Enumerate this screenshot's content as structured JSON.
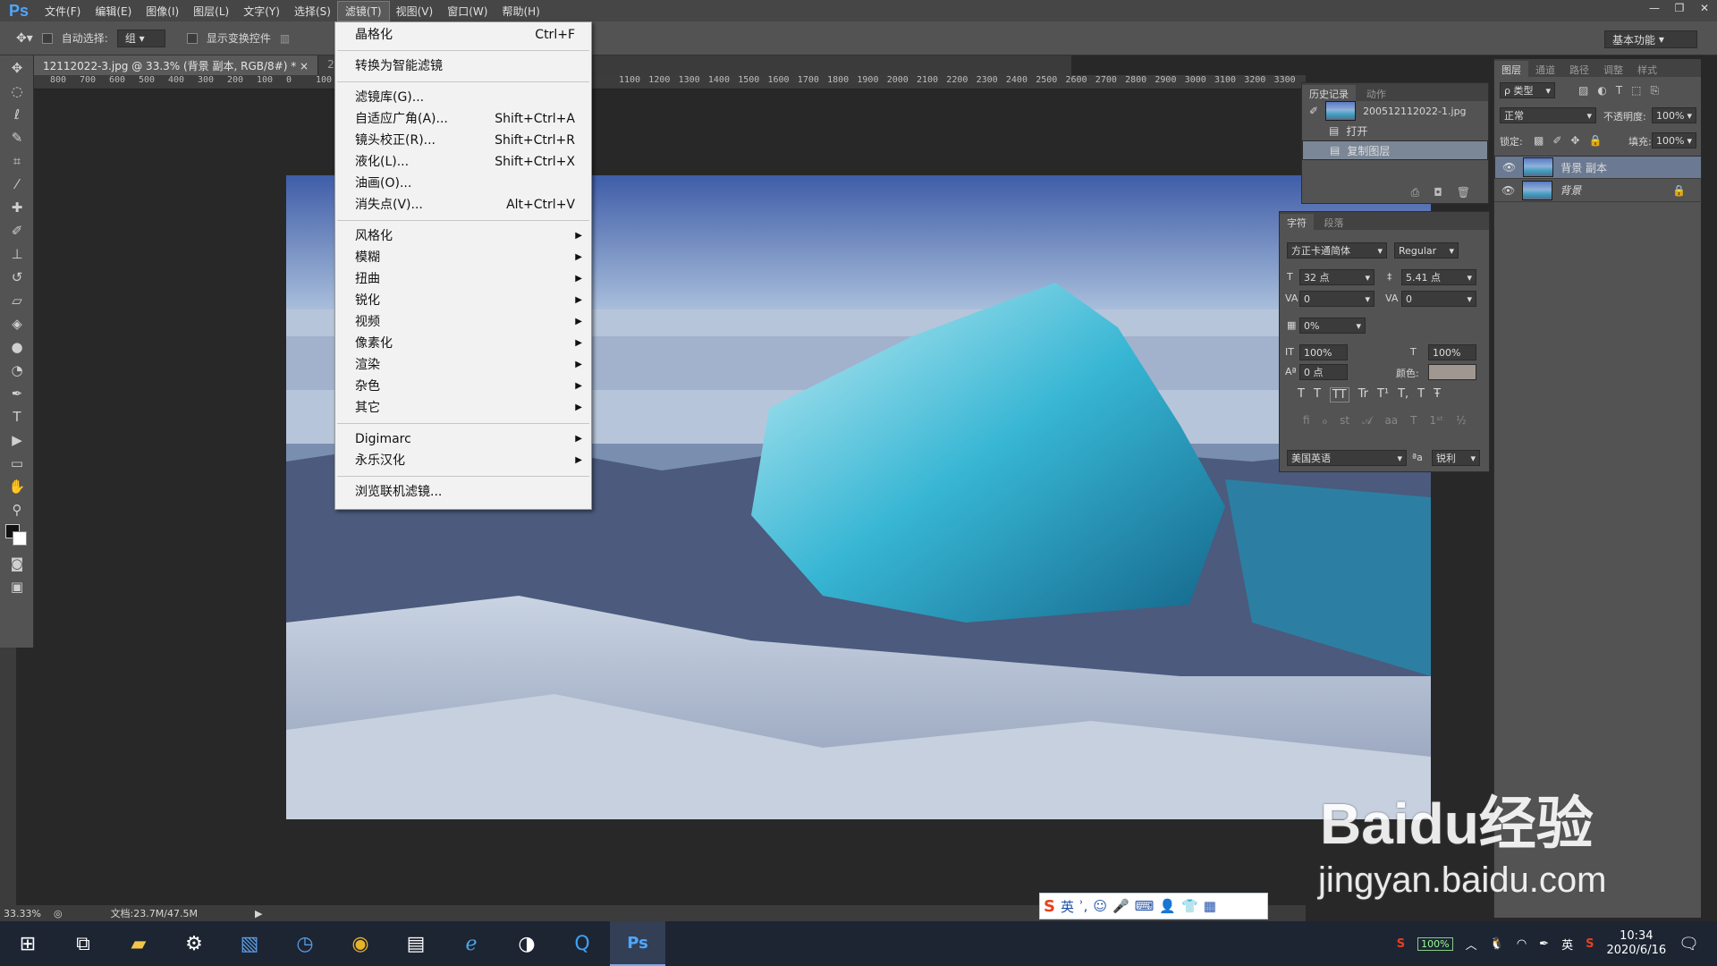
{
  "app": {
    "logo": "Ps"
  },
  "menubar": [
    "文件(F)",
    "编辑(E)",
    "图像(I)",
    "图层(L)",
    "文字(Y)",
    "选择(S)",
    "滤镜(T)",
    "视图(V)",
    "窗口(W)",
    "帮助(H)"
  ],
  "options_bar": {
    "auto_select_label": "自动选择:",
    "auto_select_value": "组",
    "show_transform_label": "显示变换控件",
    "workspace": "基本功能"
  },
  "tabs": [
    {
      "label": "12112022-3.jpg @ 33.3% (背景 副本, RGB/8#) *"
    },
    {
      "label": "2005121"
    }
  ],
  "ruler_ticks": [
    "800",
    "700",
    "600",
    "500",
    "400",
    "300",
    "200",
    "100",
    "0",
    "100",
    "1100",
    "1200",
    "1300",
    "1400",
    "1500",
    "1600",
    "1700",
    "1800",
    "1900",
    "2000",
    "2100",
    "2200",
    "2300",
    "2400",
    "2500",
    "2600",
    "2700",
    "2800",
    "2900",
    "3000",
    "3100",
    "3200",
    "3300"
  ],
  "filter_menu": {
    "items": [
      {
        "label": "晶格化",
        "shortcut": "Ctrl+F"
      },
      {
        "sep": true
      },
      {
        "label": "转换为智能滤镜"
      },
      {
        "sep": true
      },
      {
        "label": "滤镜库(G)..."
      },
      {
        "label": "自适应广角(A)...",
        "shortcut": "Shift+Ctrl+A"
      },
      {
        "label": "镜头校正(R)...",
        "shortcut": "Shift+Ctrl+R"
      },
      {
        "label": "液化(L)...",
        "shortcut": "Shift+Ctrl+X"
      },
      {
        "label": "油画(O)..."
      },
      {
        "label": "消失点(V)...",
        "shortcut": "Alt+Ctrl+V"
      },
      {
        "sep": true
      },
      {
        "label": "风格化",
        "sub": true
      },
      {
        "label": "模糊",
        "sub": true
      },
      {
        "label": "扭曲",
        "sub": true
      },
      {
        "label": "锐化",
        "sub": true
      },
      {
        "label": "视频",
        "sub": true
      },
      {
        "label": "像素化",
        "sub": true
      },
      {
        "label": "渲染",
        "sub": true
      },
      {
        "label": "杂色",
        "sub": true
      },
      {
        "label": "其它",
        "sub": true
      },
      {
        "sep": true
      },
      {
        "label": "Digimarc",
        "sub": true
      },
      {
        "label": "永乐汉化",
        "sub": true
      },
      {
        "sep": true
      },
      {
        "label": "浏览联机滤镜..."
      }
    ]
  },
  "history": {
    "tabs": [
      "历史记录",
      "动作"
    ],
    "snapshot": "200512112022-1.jpg",
    "steps": [
      "打开",
      "复制图层"
    ]
  },
  "character": {
    "tabs": [
      "字符",
      "段落"
    ],
    "font": "方正卡通简体",
    "style": "Regular",
    "size": "32 点",
    "leading": "5.41 点",
    "kerning": "0",
    "tracking": "0",
    "scale_pct": "0%",
    "vscale": "100%",
    "hscale": "100%",
    "baseline": "0 点",
    "color_label": "颜色:",
    "color": "#a09890",
    "typebuttons": [
      "T",
      "T",
      "TT",
      "Tr",
      "T¹",
      "T,",
      "T",
      "Ŧ"
    ],
    "language": "美国英语",
    "aa_label": "ªa",
    "aa": "锐利"
  },
  "layers": {
    "tabs": [
      "图层",
      "通道",
      "路径",
      "调整",
      "样式"
    ],
    "kind": "ρ 类型",
    "blend": "正常",
    "opacity_label": "不透明度:",
    "opacity": "100%",
    "lock_label": "锁定:",
    "fill_label": "填充:",
    "fill": "100%",
    "items": [
      {
        "name": "背景 副本",
        "selected": true
      },
      {
        "name": "背景",
        "locked": true
      }
    ]
  },
  "status": {
    "zoom": "33.33%",
    "doc": "文档:23.7M/47.5M"
  },
  "ime": {
    "lang": "英"
  },
  "tray": {
    "battery": "100%",
    "lang": "英",
    "time": "10:34",
    "date": "2020/6/16"
  },
  "watermark": {
    "brand": "Baidu经验",
    "url": "jingyan.baidu.com"
  }
}
